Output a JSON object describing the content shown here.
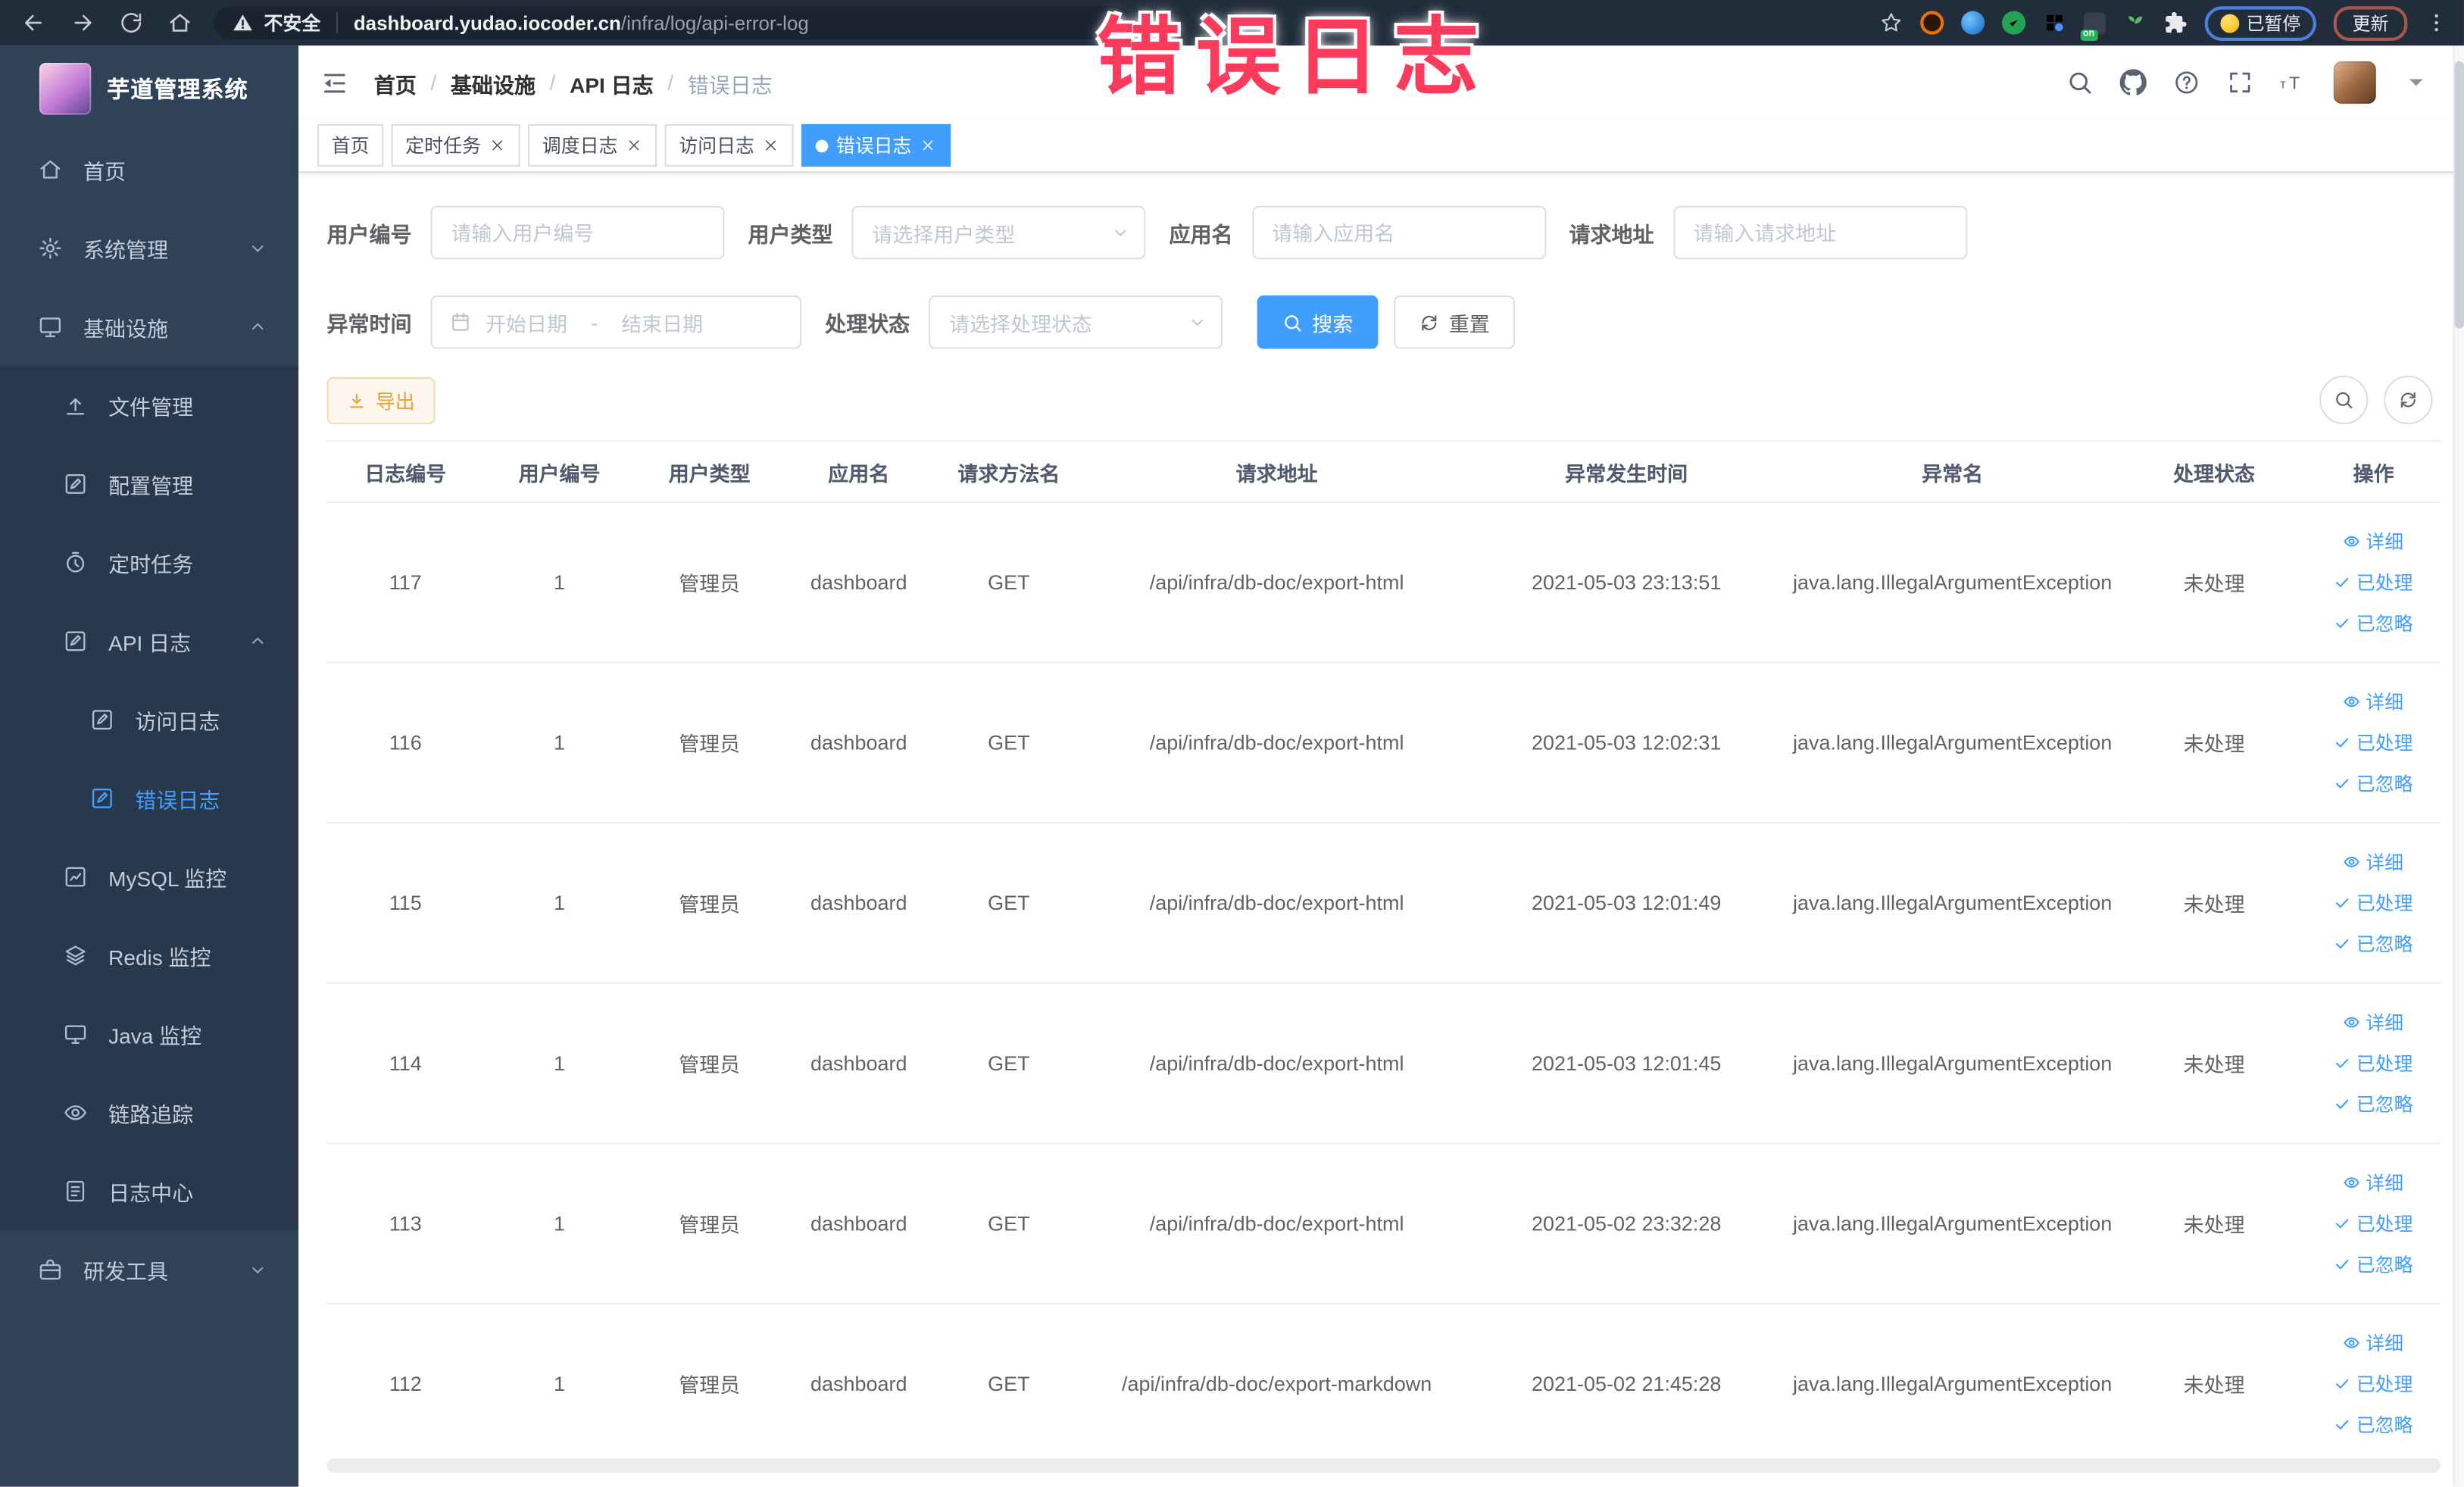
{
  "browser": {
    "security_label": "不安全",
    "url_host": "dashboard.yudao.iocoder.cn",
    "url_path": "/infra/log/api-error-log",
    "extension_badge": "on",
    "paused_badge": "已暂停",
    "update_button": "更新"
  },
  "watermark": "错误日志",
  "colors": {
    "accent": "#409eff",
    "sidebar_bg": "#2f4257",
    "submenu_bg": "#28394d",
    "active_tab": "#409eff",
    "warning_button": "#e6a23c",
    "watermark": "#fb3a5c",
    "browser_bar": "#222d3c"
  },
  "sidebar": {
    "title": "芋道管理系统",
    "items": [
      {
        "key": "home",
        "label": "首页",
        "icon": "home",
        "level": 0
      },
      {
        "key": "system-management",
        "label": "系统管理",
        "icon": "gear",
        "level": 0,
        "chevron": "down"
      },
      {
        "key": "infrastructure",
        "label": "基础设施",
        "icon": "monitor",
        "level": 0,
        "chevron": "up"
      },
      {
        "key": "file-management",
        "label": "文件管理",
        "icon": "upload",
        "level": 1
      },
      {
        "key": "config-management",
        "label": "配置管理",
        "icon": "edit",
        "level": 1
      },
      {
        "key": "scheduled-tasks",
        "label": "定时任务",
        "icon": "timer",
        "level": 1
      },
      {
        "key": "api-log",
        "label": "API 日志",
        "icon": "log",
        "level": 1,
        "chevron": "up"
      },
      {
        "key": "access-log",
        "label": "访问日志",
        "icon": "log",
        "level": 2
      },
      {
        "key": "error-log",
        "label": "错误日志",
        "icon": "log",
        "level": 2,
        "active": true
      },
      {
        "key": "mysql-monitor",
        "label": "MySQL 监控",
        "icon": "chart",
        "level": 1
      },
      {
        "key": "redis-monitor",
        "label": "Redis 监控",
        "icon": "layers",
        "level": 1
      },
      {
        "key": "java-monitor",
        "label": "Java 监控",
        "icon": "display",
        "level": 1
      },
      {
        "key": "trace",
        "label": "链路追踪",
        "icon": "eye",
        "level": 1
      },
      {
        "key": "log-center",
        "label": "日志中心",
        "icon": "doc",
        "level": 1
      },
      {
        "key": "dev-tools",
        "label": "研发工具",
        "icon": "briefcase",
        "level": 0,
        "chevron": "down"
      }
    ]
  },
  "header": {
    "breadcrumb": [
      "首页",
      "基础设施",
      "API 日志",
      "错误日志"
    ],
    "separator": "/",
    "font_size_icon_text": "тT"
  },
  "tabs": [
    {
      "key": "home",
      "label": "首页",
      "closable": false,
      "active": false
    },
    {
      "key": "scheduled-tasks",
      "label": "定时任务",
      "closable": true,
      "active": false
    },
    {
      "key": "schedule-log",
      "label": "调度日志",
      "closable": true,
      "active": false
    },
    {
      "key": "access-log",
      "label": "访问日志",
      "closable": true,
      "active": false
    },
    {
      "key": "error-log",
      "label": "错误日志",
      "closable": true,
      "active": true
    }
  ],
  "filters": {
    "user_id": {
      "label": "用户编号",
      "placeholder": "请输入用户编号"
    },
    "user_type": {
      "label": "用户类型",
      "placeholder": "请选择用户类型"
    },
    "app_name": {
      "label": "应用名",
      "placeholder": "请输入应用名"
    },
    "request_url": {
      "label": "请求地址",
      "placeholder": "请输入请求地址"
    },
    "exception_time": {
      "label": "异常时间",
      "start_placeholder": "开始日期",
      "separator": "-",
      "end_placeholder": "结束日期"
    },
    "process_status": {
      "label": "处理状态",
      "placeholder": "请选择处理状态"
    },
    "search_button": "搜索",
    "reset_button": "重置"
  },
  "toolbar": {
    "export_button": "导出"
  },
  "table": {
    "headers": [
      "日志编号",
      "用户编号",
      "用户类型",
      "应用名",
      "请求方法名",
      "请求地址",
      "异常发生时间",
      "异常名",
      "处理状态",
      "操作"
    ],
    "actions": [
      "详细",
      "已处理",
      "已忽略"
    ],
    "rows": [
      {
        "id": "117",
        "user_id": "1",
        "user_type": "管理员",
        "app_name": "dashboard",
        "method": "GET",
        "url": "/api/infra/db-doc/export-html",
        "time": "2021-05-03 23:13:51",
        "exception": "java.lang.IllegalArgumentException",
        "status": "未处理"
      },
      {
        "id": "116",
        "user_id": "1",
        "user_type": "管理员",
        "app_name": "dashboard",
        "method": "GET",
        "url": "/api/infra/db-doc/export-html",
        "time": "2021-05-03 12:02:31",
        "exception": "java.lang.IllegalArgumentException",
        "status": "未处理"
      },
      {
        "id": "115",
        "user_id": "1",
        "user_type": "管理员",
        "app_name": "dashboard",
        "method": "GET",
        "url": "/api/infra/db-doc/export-html",
        "time": "2021-05-03 12:01:49",
        "exception": "java.lang.IllegalArgumentException",
        "status": "未处理"
      },
      {
        "id": "114",
        "user_id": "1",
        "user_type": "管理员",
        "app_name": "dashboard",
        "method": "GET",
        "url": "/api/infra/db-doc/export-html",
        "time": "2021-05-03 12:01:45",
        "exception": "java.lang.IllegalArgumentException",
        "status": "未处理"
      },
      {
        "id": "113",
        "user_id": "1",
        "user_type": "管理员",
        "app_name": "dashboard",
        "method": "GET",
        "url": "/api/infra/db-doc/export-html",
        "time": "2021-05-02 23:32:28",
        "exception": "java.lang.IllegalArgumentException",
        "status": "未处理"
      },
      {
        "id": "112",
        "user_id": "1",
        "user_type": "管理员",
        "app_name": "dashboard",
        "method": "GET",
        "url": "/api/infra/db-doc/export-markdown",
        "time": "2021-05-02 21:45:28",
        "exception": "java.lang.IllegalArgumentException",
        "status": "未处理"
      }
    ]
  }
}
